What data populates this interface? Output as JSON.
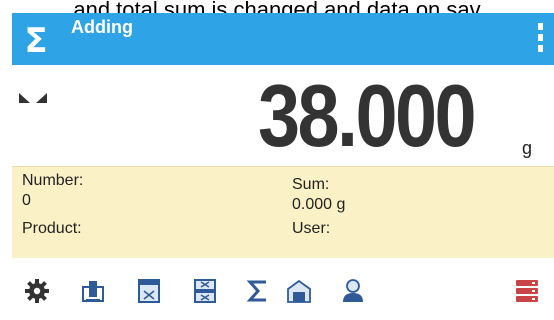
{
  "caption": "and total sum is changed and data on sav",
  "header": {
    "title": "Adding",
    "logo_symbol": "Σ",
    "background_color": "#2ea3e6"
  },
  "display": {
    "weight": "38.000",
    "unit": "g",
    "stability_indicator": "stable-icon"
  },
  "info": {
    "number_label": "Number:",
    "number_value": "0",
    "sum_label": "Sum:",
    "sum_value": "0.000 g",
    "product_label": "Product:",
    "user_label": "User:",
    "background_color": "#fbf1c7"
  },
  "toolbar": {
    "icons": [
      "gear-icon",
      "tare-icon",
      "add-icon",
      "remove-icon",
      "sum-icon",
      "warehouse-icon",
      "user-icon",
      "database-icon"
    ],
    "icon_color": "#2f5a98",
    "accent_color": "#c94545"
  }
}
